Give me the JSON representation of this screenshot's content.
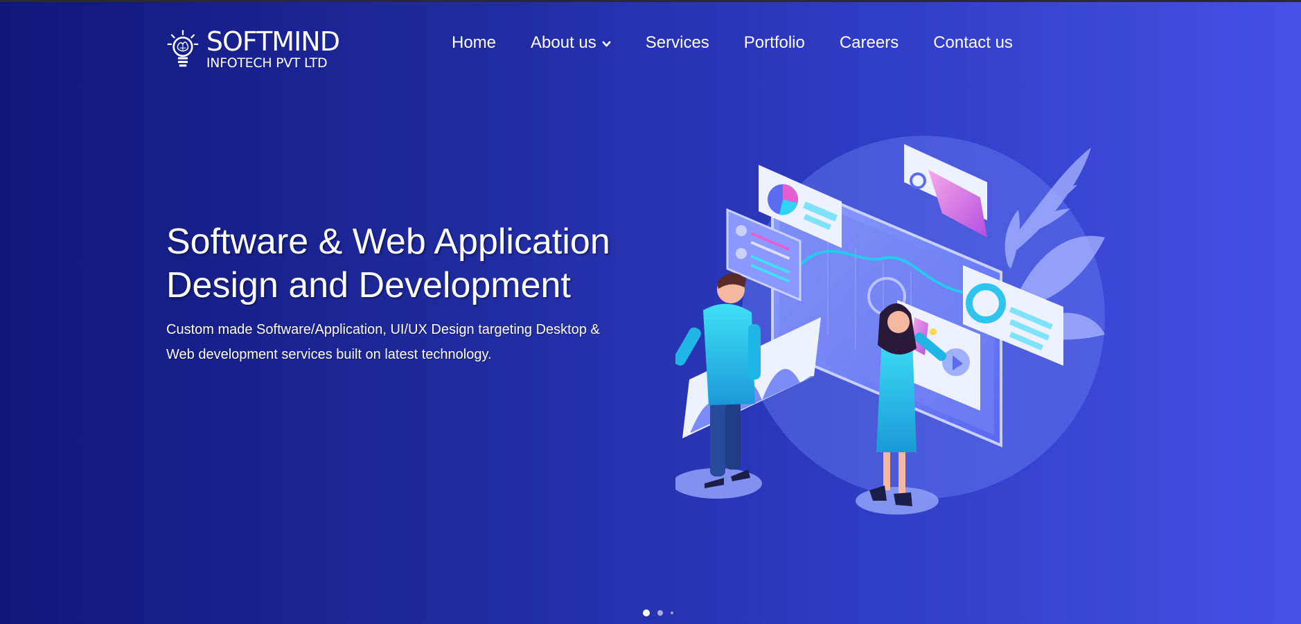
{
  "brand": {
    "name_line1": "SOFTMIND",
    "name_line2": "INFOTECH PVT LTD"
  },
  "nav": {
    "items": [
      {
        "label": "Home"
      },
      {
        "label": "About us",
        "has_dropdown": true
      },
      {
        "label": "Services"
      },
      {
        "label": "Portfolio"
      },
      {
        "label": "Careers"
      },
      {
        "label": "Contact us"
      }
    ]
  },
  "hero": {
    "title_line1": "Software & Web Application",
    "title_line2": "Design and Development",
    "subtitle_line1": "Custom made Software/Application, UI/UX Design targeting Desktop &",
    "subtitle_line2": "Web development services built on latest technology."
  },
  "carousel": {
    "slide_count": 3,
    "active_slide": 1
  },
  "colors": {
    "gradient_start": "#10177a",
    "gradient_end": "#4650e6",
    "text": "#ffffff",
    "accent_cyan": "#1fc6e8",
    "accent_pink": "#e45fd0"
  },
  "icons": [
    "lightbulb-brain-logo-icon",
    "chevron-down-icon"
  ]
}
